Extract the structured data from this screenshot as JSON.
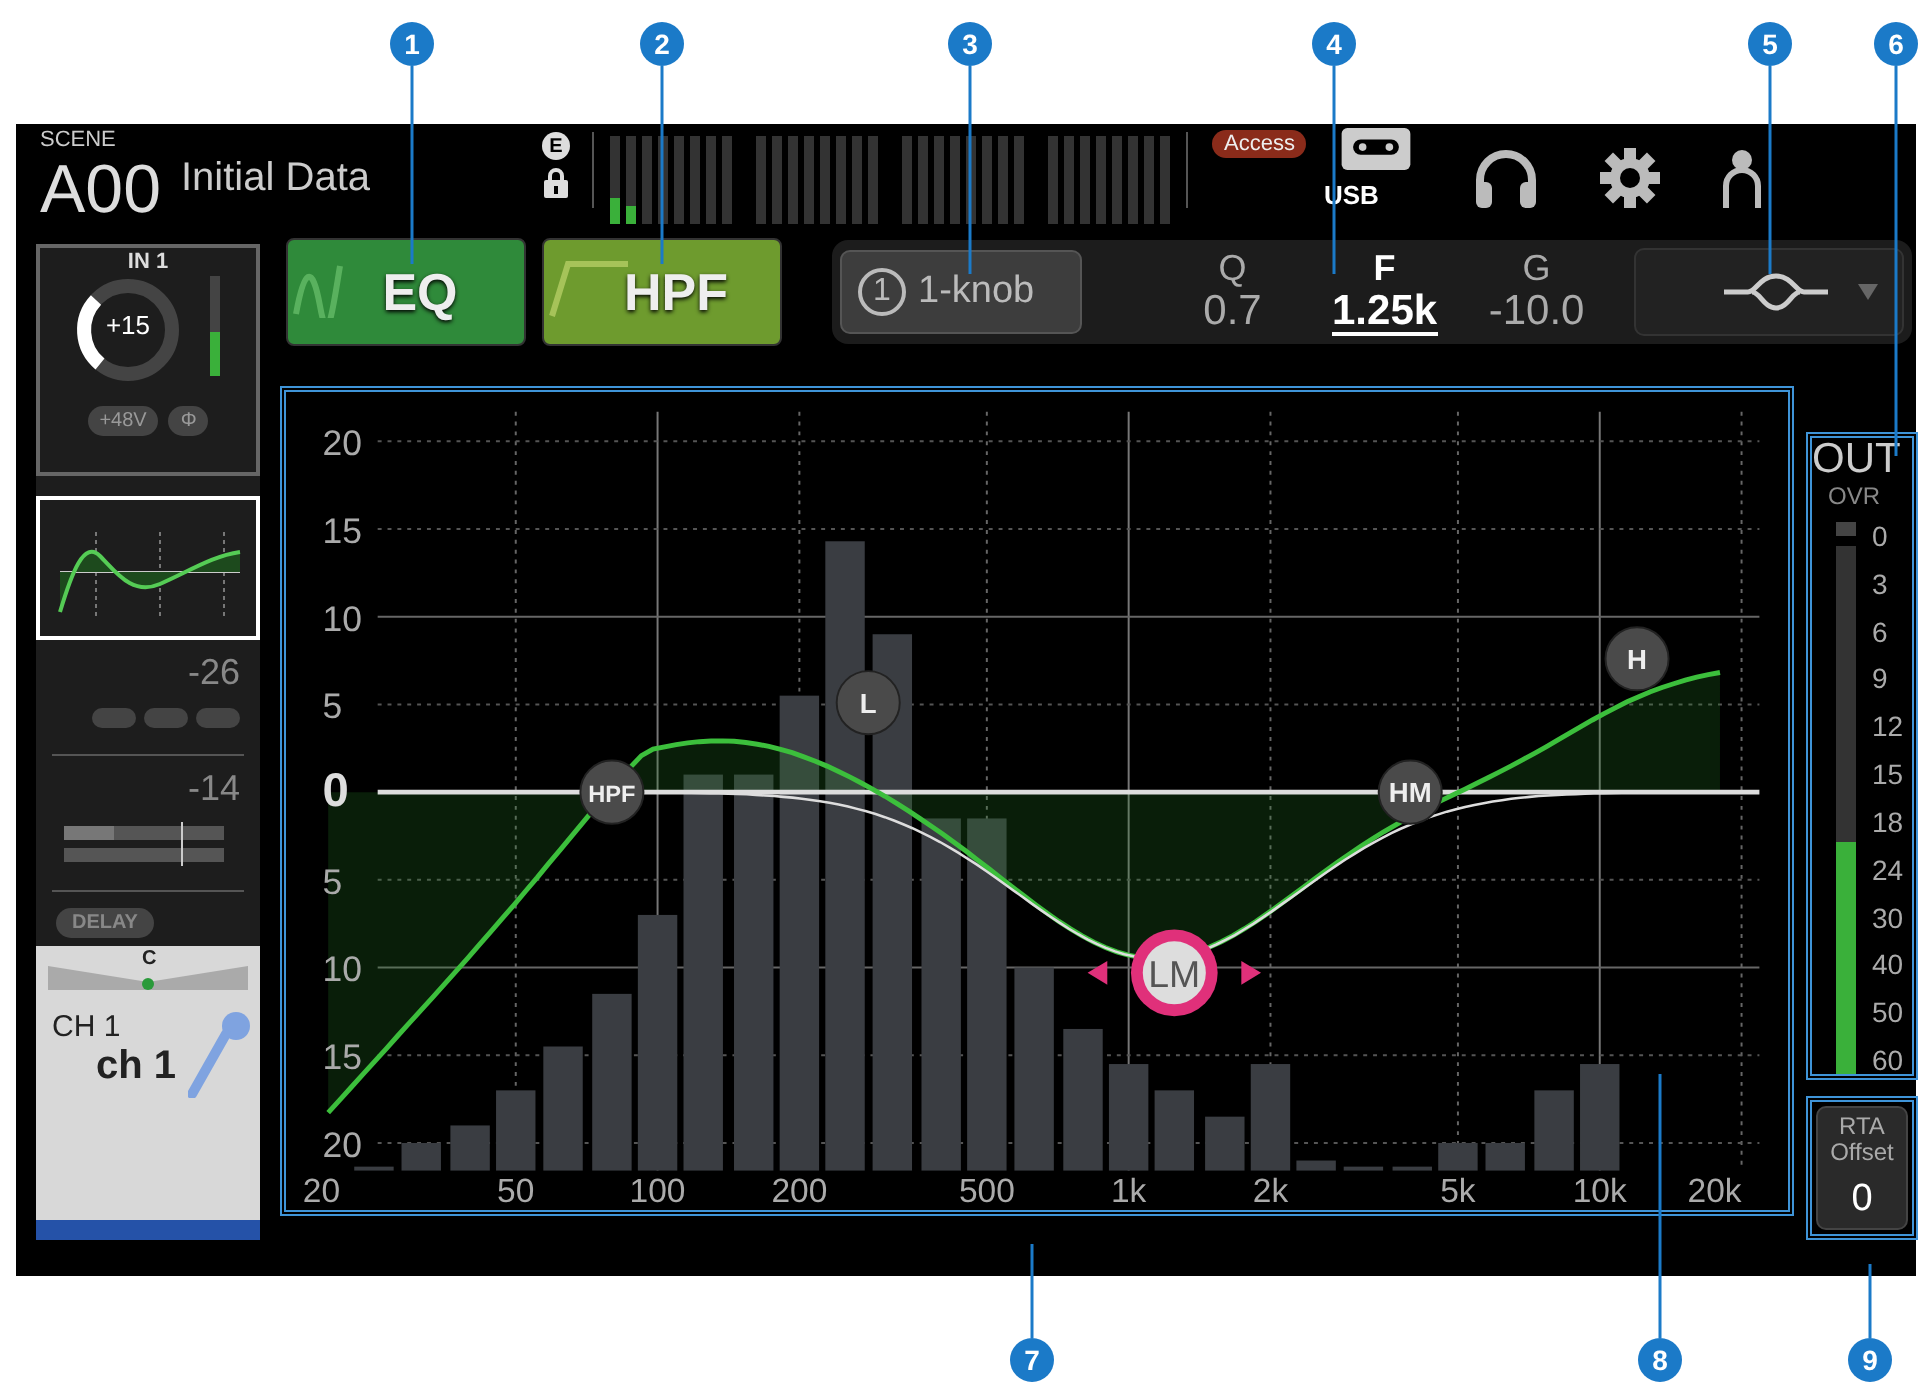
{
  "header": {
    "scene_label": "SCENE",
    "scene_number": "A00",
    "scene_title": "Initial Data",
    "edit_badge": "E",
    "access_badge": "Access",
    "usb_label": "USB",
    "input_meters": [
      {
        "level": 0.3
      },
      {
        "level": 0.2
      }
    ]
  },
  "channel_strip": {
    "input": "IN 1",
    "gain": "+15",
    "gain_meter": {
      "level": 0.45
    },
    "phantom": "+48V",
    "phase": "Φ",
    "eq_thumbnail": {
      "selected": true
    },
    "dynamics_1": "-26",
    "dynamics_2": "-14",
    "delay": "DELAY",
    "pan": "C",
    "channel_id": "CH 1",
    "channel_name": "ch 1"
  },
  "eq_button": {
    "label": "EQ",
    "on": true
  },
  "hpf_button": {
    "label": "HPF",
    "on": true
  },
  "knob_button": {
    "number": "1",
    "label": "1-knob"
  },
  "parameters": [
    {
      "name": "Q",
      "value": "0.7",
      "selected": false
    },
    {
      "name": "F",
      "value": "1.25k",
      "selected": true
    },
    {
      "name": "G",
      "value": "-10.0",
      "selected": false
    }
  ],
  "graph": {
    "y_labels": [
      "20",
      "15",
      "10",
      "5",
      "0",
      "5",
      "10",
      "15",
      "20"
    ],
    "x_labels": [
      "20",
      "50",
      "100",
      "200",
      "500",
      "1k",
      "2k",
      "5k",
      "10k",
      "20k"
    ],
    "bands": [
      {
        "label": "HPF",
        "selected": false
      },
      {
        "label": "L",
        "selected": false
      },
      {
        "label": "LM",
        "selected": true
      },
      {
        "label": "HM",
        "selected": false
      },
      {
        "label": "H",
        "selected": false
      }
    ]
  },
  "out_meter": {
    "title": "OUT",
    "overload": "OVR",
    "scale": [
      "0",
      "3",
      "6",
      "9",
      "12",
      "15",
      "18",
      "24",
      "30",
      "40",
      "50",
      "60"
    ],
    "level": 0.44
  },
  "rta_offset": {
    "label": "RTA Offset",
    "value": "0"
  },
  "callouts": [
    "1",
    "2",
    "3",
    "4",
    "5",
    "6",
    "7",
    "8",
    "9"
  ]
}
